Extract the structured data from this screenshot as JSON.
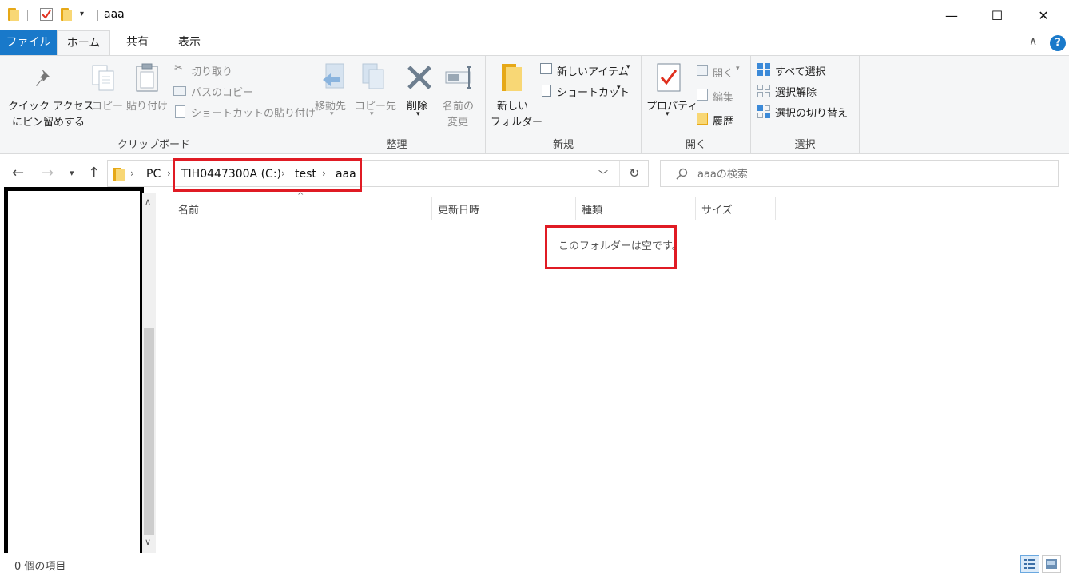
{
  "window": {
    "title": "aaa",
    "minimize": "—",
    "maximize": "☐",
    "close": "✕"
  },
  "tabs": {
    "file": "ファイル",
    "home": "ホーム",
    "share": "共有",
    "view": "表示"
  },
  "ribbon": {
    "clipboard": {
      "label": "クリップボード",
      "pin_line1": "クイック アクセス",
      "pin_line2": "にピン留めする",
      "copy": "コピー",
      "paste": "貼り付け",
      "cut": "切り取り",
      "copy_path": "パスのコピー",
      "paste_shortcut": "ショートカットの貼り付け"
    },
    "organize": {
      "label": "整理",
      "move_to": "移動先",
      "copy_to": "コピー先",
      "delete": "削除",
      "rename_line1": "名前の",
      "rename_line2": "変更"
    },
    "new": {
      "label": "新規",
      "new_folder_line1": "新しい",
      "new_folder_line2": "フォルダー",
      "new_item": "新しいアイテム",
      "shortcut": "ショートカット"
    },
    "open": {
      "label": "開く",
      "properties": "プロパティ",
      "open": "開く",
      "edit": "編集",
      "history": "履歴"
    },
    "select": {
      "label": "選択",
      "select_all": "すべて選択",
      "select_none": "選択解除",
      "invert": "選択の切り替え"
    }
  },
  "address": {
    "crumbs": [
      "PC",
      "TIH0447300A (C:)",
      "test",
      "aaa"
    ],
    "search_placeholder": "aaaの検索"
  },
  "columns": [
    "名前",
    "更新日時",
    "種類",
    "サイズ"
  ],
  "content": {
    "empty_message": "このフォルダーは空です。"
  },
  "status": {
    "item_count": "0 個の項目"
  },
  "colors": {
    "accent": "#1979ca",
    "highlight": "#e01b24"
  }
}
